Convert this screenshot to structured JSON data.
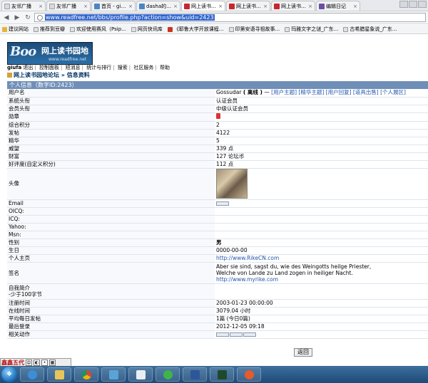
{
  "browser": {
    "tabs": [
      {
        "label": "友邻广播",
        "active": false,
        "icon": "doc-icon"
      },
      {
        "label": "友邻广播",
        "active": false,
        "icon": "doc-icon"
      },
      {
        "label": "首页 - giufa ...",
        "active": false,
        "icon": "site-icon"
      },
      {
        "label": "dasha的圈...",
        "active": false,
        "icon": "site-icon"
      },
      {
        "label": "网上读书园...",
        "active": true,
        "icon": "red-icon"
      },
      {
        "label": "网上读书园...",
        "active": false,
        "icon": "red-icon"
      },
      {
        "label": "网上读书园...",
        "active": false,
        "icon": "red-icon"
      },
      {
        "label": "编辑日记",
        "active": false,
        "icon": "purple-icon"
      }
    ],
    "url": "www.readfree.net/bbs/profile.php?action=show&uid=2423",
    "bookmarks": [
      {
        "label": "建议网站"
      },
      {
        "label": "推荐到豆瓣"
      },
      {
        "label": "欢迎使用赛风（Psip..."
      },
      {
        "label": "网页快讯库"
      },
      {
        "label": "《耶鲁大学开放课程..."
      },
      {
        "label": "印第安语寻祖故事..."
      },
      {
        "label": "玛雅文字之谜_广东..."
      },
      {
        "label": "古希腊星象说_广东..."
      }
    ]
  },
  "forum": {
    "logo_en": "Boo",
    "logo_cn": "网上读书园地",
    "logo_url": "www.readfree.net",
    "nav": {
      "user": "giufa",
      "items": [
        "退出",
        "控制面板",
        "短消息",
        "统计与排行",
        "搜索",
        "社区服务",
        "帮助"
      ]
    },
    "breadcrumb": {
      "forum": "网上读书园地论坛",
      "separator": "»",
      "page": "信息资料"
    },
    "profile_header": "个人信息（数字ID:2423）",
    "back_label": "返回"
  },
  "profile": {
    "username_label": "用户名",
    "username": "Gossudar",
    "status": "( 离线 )",
    "status_prefix": "—",
    "username_links": "[用户主题] [精华主题] [用户回复] [道具出售] [个人展区]",
    "rows": {
      "system_title": {
        "label": "系统头衔",
        "value": "认证会员"
      },
      "member_title": {
        "label": "会员头衔",
        "value": "中级认证会员"
      },
      "medal": {
        "label": "勋章",
        "value": ""
      },
      "points": {
        "label": "综合积分",
        "value": "2"
      },
      "posts": {
        "label": "发帖",
        "value": "4122"
      },
      "digest": {
        "label": "精华",
        "value": "5"
      },
      "prestige": {
        "label": "威望",
        "value": "339 点"
      },
      "wealth": {
        "label": "财富",
        "value": "127 论坛币"
      },
      "goodwill": {
        "label": "好评度(自定义积分)",
        "value": "112 点"
      },
      "avatar": {
        "label": "头像",
        "value": ""
      },
      "email": {
        "label": "Email",
        "value": ""
      },
      "oicq": {
        "label": "OICQ:",
        "value": ""
      },
      "icq": {
        "label": "ICQ:",
        "value": ""
      },
      "yahoo": {
        "label": "Yahoo:",
        "value": ""
      },
      "msn": {
        "label": "Msn:",
        "value": ""
      },
      "gender": {
        "label": "性别",
        "value": "男"
      },
      "birthday": {
        "label": "生日",
        "value": "0000-00-00"
      },
      "homepage": {
        "label": "个人主页",
        "value": "http://www.RikeCN.com"
      },
      "signature": {
        "label": "签名",
        "line1": "Aber sie sind, sagst du, wie des Weingotts heilge Priester,",
        "line2": "Welche von Lande zu Land zogen in heiliger Nacht.",
        "line3": "http://www.myrike.com"
      },
      "intro": {
        "label_line1": "自我简介",
        "label_line2": "-少于100字节",
        "value": ""
      },
      "registered": {
        "label": "注册时间",
        "value": "2003-01-23 00:00:00"
      },
      "online_time": {
        "label": "在线时间",
        "value": "3079.04 小时"
      },
      "daily_posts": {
        "label": "平均每日发帖",
        "value": "1篇 (今日0篇)"
      },
      "last_login": {
        "label": "最后登录",
        "value": "2012-12-05 09:18"
      },
      "actions": {
        "label": "相关动作",
        "value": ""
      }
    }
  },
  "ime": {
    "name": "鑫鑫五代"
  },
  "taskbar": {
    "start_icon": "windows-start-icon",
    "items": [
      "ie-icon",
      "folder-icon",
      "chrome-icon",
      "photo-viewer-icon",
      "paper-icon",
      "media-icon",
      "word-icon",
      "terminal-icon",
      "app-icon"
    ]
  }
}
